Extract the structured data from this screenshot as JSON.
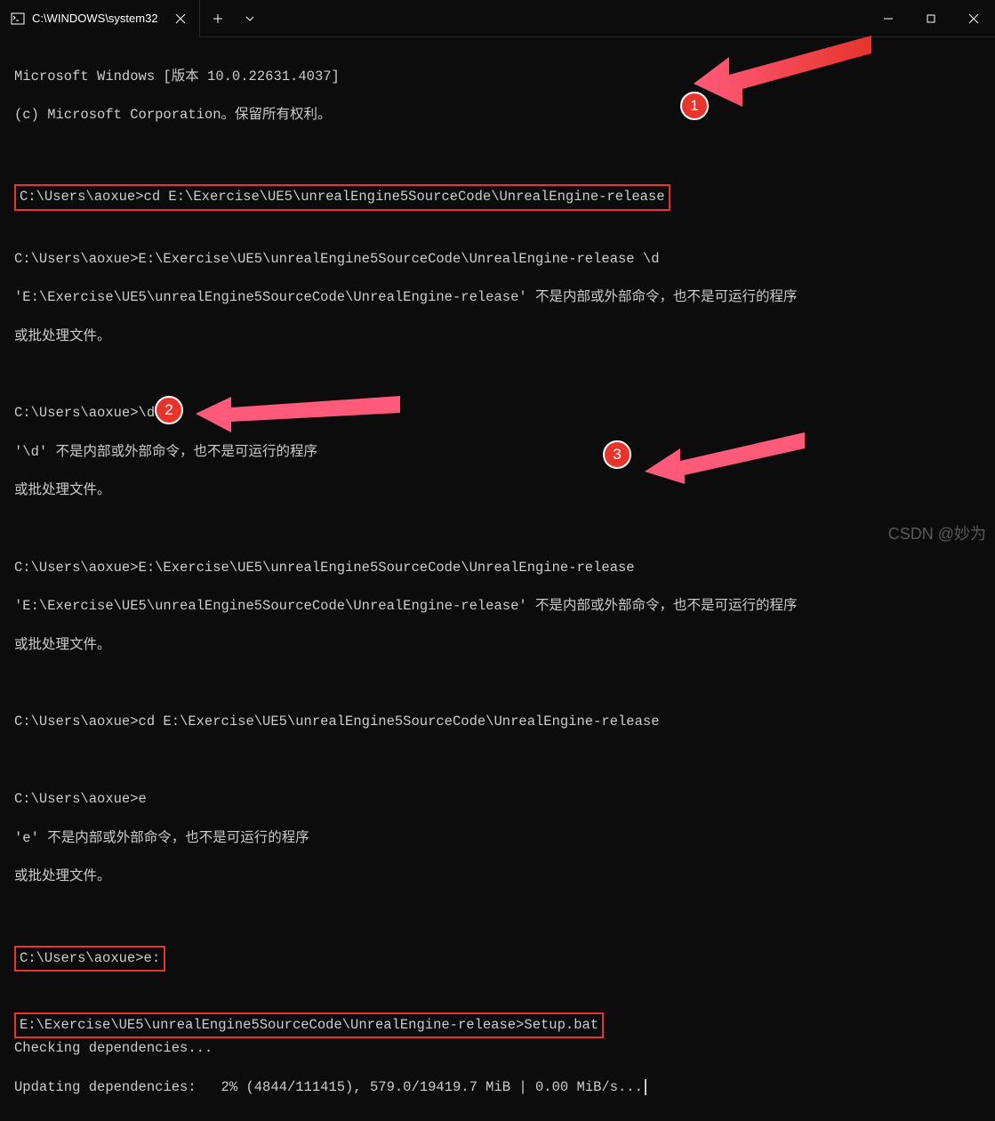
{
  "titlebar": {
    "tab_title": "C:\\WINDOWS\\system32"
  },
  "terminal": {
    "header1": "Microsoft Windows [版本 10.0.22631.4037]",
    "header2": "(c) Microsoft Corporation。保留所有权利。",
    "cmd1_prompt": "C:\\Users\\aoxue>",
    "cmd1_text": "cd E:\\Exercise\\UE5\\unrealEngine5SourceCode\\UnrealEngine-release",
    "cmd2_line": "C:\\Users\\aoxue>E:\\Exercise\\UE5\\unrealEngine5SourceCode\\UnrealEngine-release \\d",
    "err2a": "'E:\\Exercise\\UE5\\unrealEngine5SourceCode\\UnrealEngine-release' 不是内部或外部命令，也不是可运行的程序",
    "err2b": "或批处理文件。",
    "cmd3_line": "C:\\Users\\aoxue>\\d",
    "err3a": "'\\d' 不是内部或外部命令，也不是可运行的程序",
    "err3b": "或批处理文件。",
    "cmd4_line": "C:\\Users\\aoxue>E:\\Exercise\\UE5\\unrealEngine5SourceCode\\UnrealEngine-release",
    "err4a": "'E:\\Exercise\\UE5\\unrealEngine5SourceCode\\UnrealEngine-release' 不是内部或外部命令，也不是可运行的程序",
    "err4b": "或批处理文件。",
    "cmd5_line": "C:\\Users\\aoxue>cd E:\\Exercise\\UE5\\unrealEngine5SourceCode\\UnrealEngine-release",
    "cmd6_line": "C:\\Users\\aoxue>e",
    "err6a": "'e' 不是内部或外部命令，也不是可运行的程序",
    "err6b": "或批处理文件。",
    "cmd7_prompt": "C:\\Users\\aoxue>",
    "cmd7_text": "e:",
    "cmd8_prompt": "E:\\Exercise\\UE5\\unrealEngine5SourceCode\\UnrealEngine-release>",
    "cmd8_text": "Setup.bat",
    "out8a": "Checking dependencies...",
    "out8b": "Updating dependencies:   2% (4844/111415), 579.0/19419.7 MiB | 0.00 MiB/s..."
  },
  "annotations": {
    "num1": "1",
    "num2": "2",
    "num3": "3"
  },
  "watermark": "CSDN @妙为",
  "colors": {
    "accent": "#e7352c"
  }
}
